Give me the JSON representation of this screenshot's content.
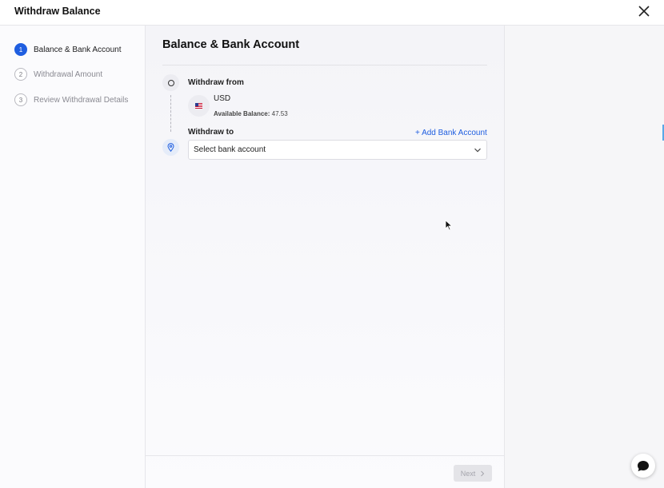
{
  "window": {
    "title": "Withdraw Balance",
    "close_icon": "close-icon"
  },
  "steps": [
    {
      "number": "1",
      "label": "Balance & Bank Account",
      "active": true
    },
    {
      "number": "2",
      "label": "Withdrawal Amount",
      "active": false
    },
    {
      "number": "3",
      "label": "Review Withdrawal Details",
      "active": false
    }
  ],
  "main": {
    "section_title": "Balance & Bank Account",
    "withdraw_from": {
      "label": "Withdraw from",
      "flag_icon": "us-flag-icon",
      "currency": "USD",
      "balance_label": "Available Balance:",
      "balance_value": "47.53"
    },
    "withdraw_to": {
      "label": "Withdraw to",
      "add_bank_label": "+ Add Bank Account",
      "select_placeholder": "Select bank account"
    }
  },
  "footer": {
    "next_label": "Next"
  },
  "colors": {
    "accent": "#1f5ee0",
    "disabled_button": "#e4e4e8"
  }
}
